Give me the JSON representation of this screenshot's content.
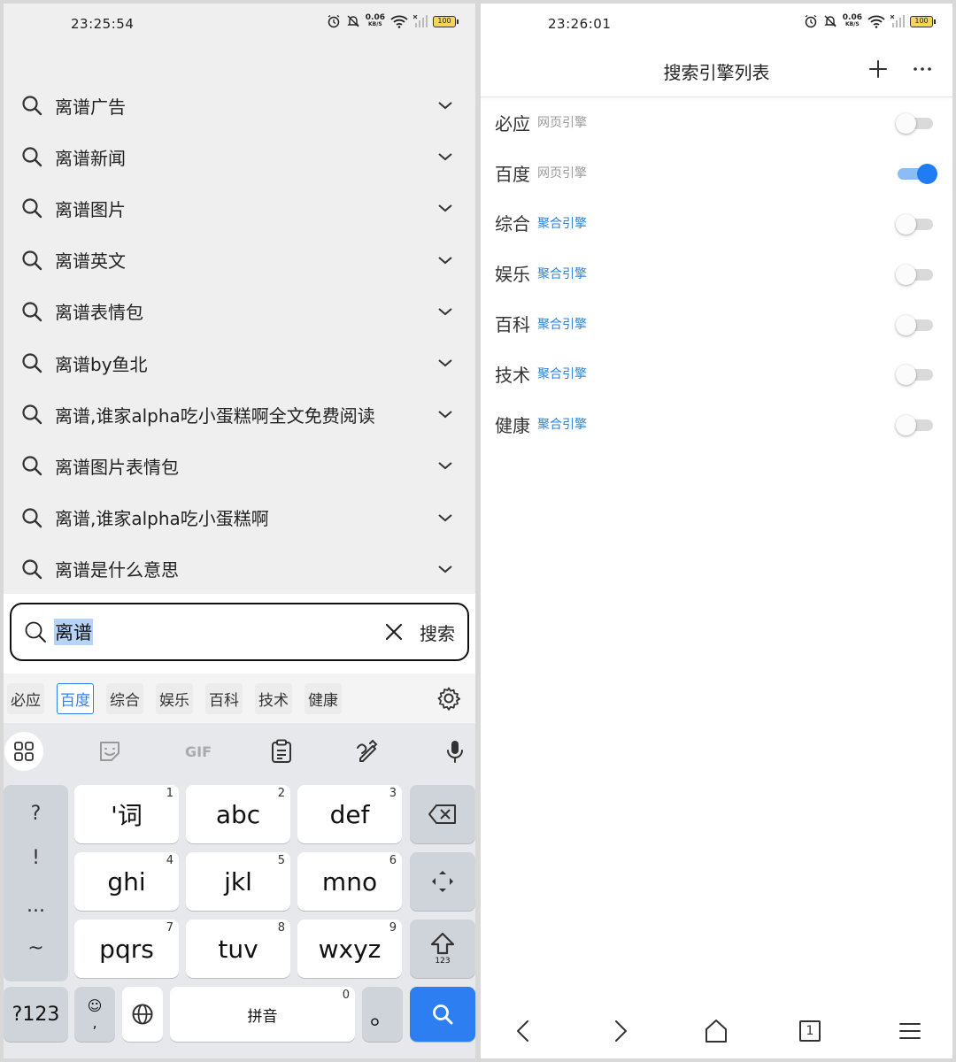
{
  "left": {
    "status": {
      "time": "23:25:54",
      "net_speed": "0.06",
      "net_unit": "KB/S",
      "battery": "100"
    },
    "suggestions": [
      "离谱广告",
      "离谱新闻",
      "离谱图片",
      "离谱英文",
      "离谱表情包",
      "离谱by鱼北",
      "离谱,谁家alpha吃小蛋糕啊全文免费阅读",
      "离谱图片表情包",
      "离谱,谁家alpha吃小蛋糕啊",
      "离谱是什么意思"
    ],
    "search": {
      "query": "离谱",
      "submit_label": "搜索"
    },
    "engines": [
      {
        "label": "必应",
        "active": false
      },
      {
        "label": "百度",
        "active": true
      },
      {
        "label": "综合",
        "active": false
      },
      {
        "label": "娱乐",
        "active": false
      },
      {
        "label": "百科",
        "active": false
      },
      {
        "label": "技术",
        "active": false
      },
      {
        "label": "健康",
        "active": false
      }
    ],
    "keyboard": {
      "toolbar": {
        "gif_label": "GIF"
      },
      "symbols": [
        "?",
        "!",
        "...",
        "~"
      ],
      "keys": [
        {
          "label": "'词",
          "num": "1"
        },
        {
          "label": "abc",
          "num": "2"
        },
        {
          "label": "def",
          "num": "3"
        },
        {
          "label": "ghi",
          "num": "4"
        },
        {
          "label": "jkl",
          "num": "5"
        },
        {
          "label": "mno",
          "num": "6"
        },
        {
          "label": "pqrs",
          "num": "7"
        },
        {
          "label": "tuv",
          "num": "8"
        },
        {
          "label": "wxyz",
          "num": "9"
        }
      ],
      "shift_sub": "123",
      "mode_label": "?123",
      "emoji_sub": ",",
      "space_label": "拼音",
      "space_num": "0",
      "period_label": "。"
    }
  },
  "right": {
    "status": {
      "time": "23:26:01",
      "net_speed": "0.06",
      "net_unit": "KB/S",
      "battery": "100"
    },
    "title": "搜索引擎列表",
    "engines": [
      {
        "name": "必应",
        "type": "网页引擎",
        "aggregate": false,
        "enabled": false
      },
      {
        "name": "百度",
        "type": "网页引擎",
        "aggregate": false,
        "enabled": true
      },
      {
        "name": "综合",
        "type": "聚合引擎",
        "aggregate": true,
        "enabled": false
      },
      {
        "name": "娱乐",
        "type": "聚合引擎",
        "aggregate": true,
        "enabled": false
      },
      {
        "name": "百科",
        "type": "聚合引擎",
        "aggregate": true,
        "enabled": false
      },
      {
        "name": "技术",
        "type": "聚合引擎",
        "aggregate": true,
        "enabled": false
      },
      {
        "name": "健康",
        "type": "聚合引擎",
        "aggregate": true,
        "enabled": false
      }
    ],
    "nav": {
      "tab_count": "1"
    }
  },
  "colors": {
    "accent": "#2d7ff1",
    "aggregate_label": "#2b83d6",
    "web_label": "#9a9a9a"
  }
}
